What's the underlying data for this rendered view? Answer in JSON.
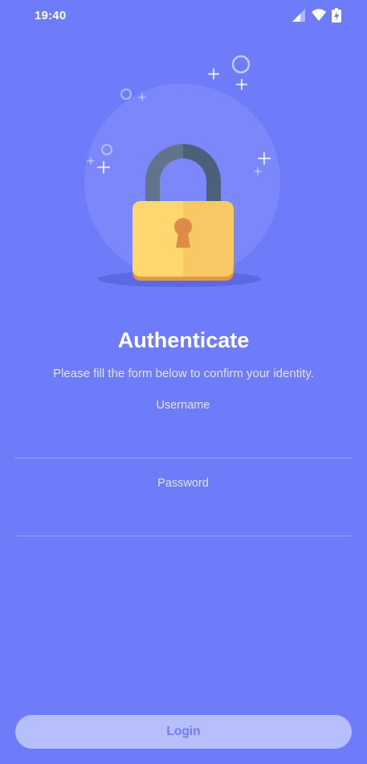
{
  "status_bar": {
    "time": "19:40",
    "icons": [
      "signal-icon",
      "wifi-icon",
      "battery-charging-icon"
    ]
  },
  "illustration": {
    "icon": "padlock-icon"
  },
  "title": "Authenticate",
  "subtitle": "Please fill the form below to confirm your identity.",
  "form": {
    "username": {
      "label": "Username",
      "value": "",
      "placeholder": ""
    },
    "password": {
      "label": "Password",
      "value": "",
      "placeholder": ""
    }
  },
  "login_button": {
    "label": "Login",
    "enabled": false
  },
  "colors": {
    "background": "#6f7cfa",
    "button_bg": "#b7befc",
    "lock_body": "#fdd36e",
    "lock_shackle": "#5b6f8c",
    "keyhole": "#e08d45"
  }
}
